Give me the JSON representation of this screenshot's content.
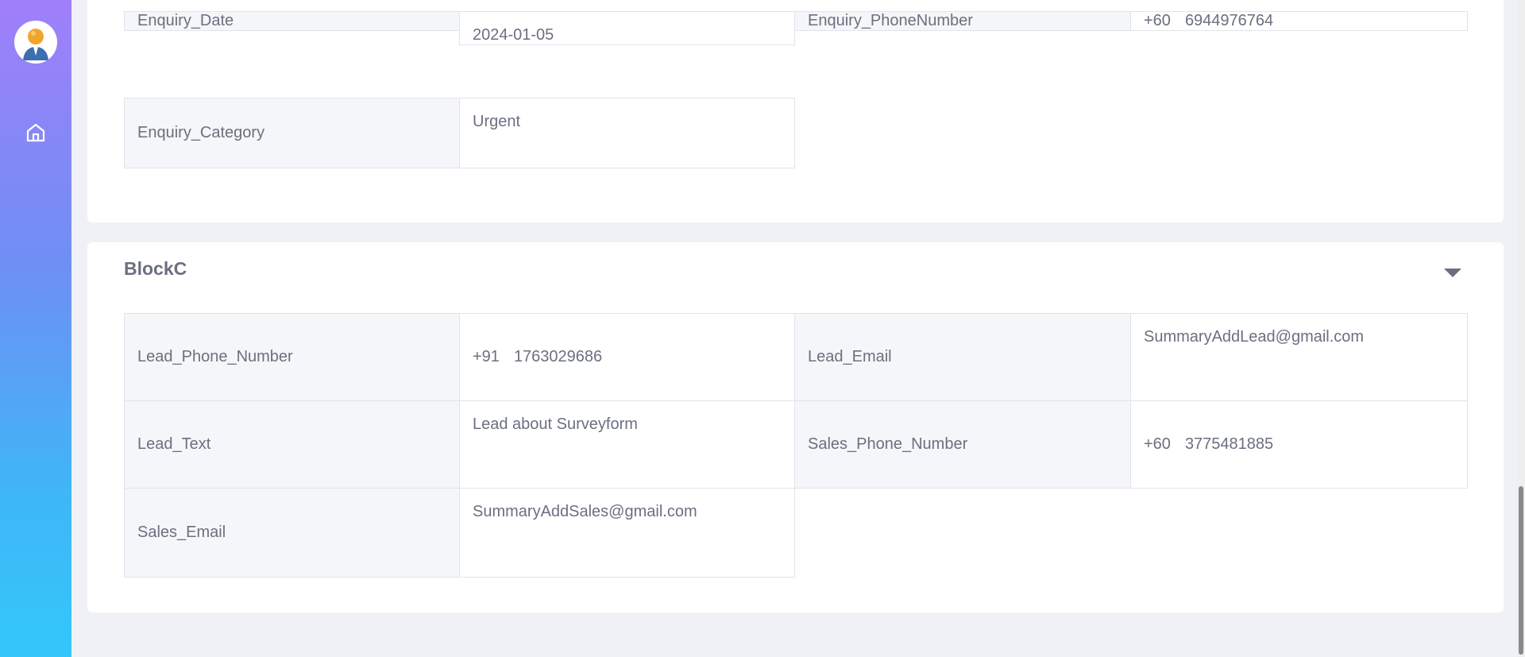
{
  "block_b": {
    "rows": [
      {
        "label1": "Enquiry_Date",
        "value1": "2024-01-05",
        "label2": "Enquiry_PhoneNumber",
        "value2_code": "+60",
        "value2_number": "6944976764"
      },
      {
        "label1": "Enquiry_Category",
        "value1": "Urgent"
      }
    ]
  },
  "block_c": {
    "title": "BlockC",
    "rows": [
      {
        "label1": "Lead_Phone_Number",
        "value1_code": "+91",
        "value1_number": "1763029686",
        "label2": "Lead_Email",
        "value2": "SummaryAddLead@gmail.com"
      },
      {
        "label1": "Lead_Text",
        "value1": "Lead about Surveyform",
        "label2": "Sales_Phone_Number",
        "value2_code": "+60",
        "value2_number": "3775481885"
      },
      {
        "label1": "Sales_Email",
        "value1": "SummaryAddSales@gmail.com"
      }
    ]
  },
  "icons": {
    "avatar": "user-avatar",
    "home": "home-icon",
    "collapse": "caret-down-icon"
  },
  "colors": {
    "sidebar_top": "#a07ffa",
    "sidebar_bottom": "#33c7fb",
    "page_bg": "#f0f1f7",
    "label_bg": "#f5f6f9",
    "text": "#6b6f80"
  }
}
